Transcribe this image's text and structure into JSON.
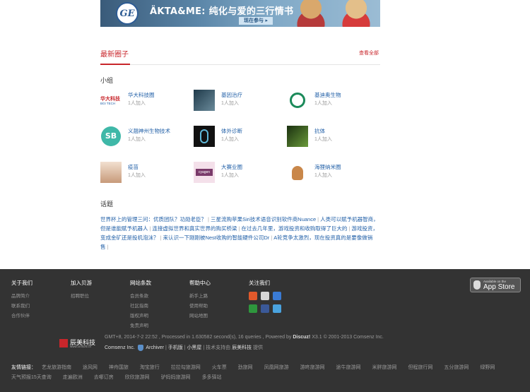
{
  "banner": {
    "ge_text": "GE",
    "title": "ÄKTA&ME: 纯化与爱的三行情书",
    "cta": "现在参与 ▸"
  },
  "section": {
    "title": "最新圈子",
    "see_all": "查看全部"
  },
  "groups_title": "小组",
  "groups": [
    {
      "name": "华大科技圈",
      "members": "1人加入",
      "thumb_text": "华大科技",
      "thumb_sub": "BGI TECH"
    },
    {
      "name": "基因治疗",
      "members": "1人加入"
    },
    {
      "name": "基迪奥生物",
      "members": "1人加入"
    },
    {
      "name": "义翘神州生物技术",
      "members": "1人加入",
      "thumb_text": "SB"
    },
    {
      "name": "体外诊断",
      "members": "1人加入"
    },
    {
      "name": "抗体",
      "members": "1人加入"
    },
    {
      "name": "疫苗",
      "members": "1人加入"
    },
    {
      "name": "大赛业圈",
      "members": "1人加入",
      "thumb_text": "cyagen"
    },
    {
      "name": "海狸纳米圈",
      "members": "1人加入"
    }
  ],
  "topics_title": "话题",
  "topics": [
    "世界杯上的管理三问：优质团队？功勋老臣？",
    "三星流购苹果Siri技术语音识别软件商Nuance",
    "人类可以赋予机器智商，但是谁能赋予机器人",
    "连接虚拟世界和真实世界的购买桥梁",
    "在过去几年里，游戏投资和收购取得了巨大的",
    "游戏投资，变成金矿还是投机泡沫？",
    "来认识一下刚刚被Nest收购的智能硬件公司Dr",
    "A轮竞争太激烈，现在投资真的是要像做销售"
  ],
  "footer": {
    "columns": [
      {
        "heading": "关于我们",
        "links": [
          "品牌简介",
          "联系我们",
          "合作伙伴"
        ]
      },
      {
        "heading": "加入贝游",
        "links": [
          "招聘职位"
        ]
      },
      {
        "heading": "网站条款",
        "links": [
          "会员条款",
          "社区指南",
          "版权声明",
          "免责声明"
        ]
      },
      {
        "heading": "帮助中心",
        "links": [
          "新手上路",
          "使用帮助",
          "网站地图"
        ]
      },
      {
        "heading": "关注我们",
        "links": []
      }
    ],
    "appstore_small": "Available on the",
    "appstore_big": "App Store",
    "company_name": "辰美科技",
    "company_url": "www.cmsoft.cn",
    "copyright_line": "GMT+8, 2014-7-2 22:52 , Processed in 1.630582 second(s), 16 queries , Powered by",
    "powered_by": "Discuz!",
    "version": "X3.1 © 2001-2013 Comsenz Inc.",
    "comsenz": "Comsenz Inc.",
    "archiver": "Archiver",
    "mobile": "手机版",
    "blackroom": "小黑屋",
    "tech_support": "技术支持由",
    "tech_company": "辰美科技",
    "tech_suffix": "提供",
    "links_label": "友情链接：",
    "friend_links": [
      "艺龙旅游指南",
      "途风网",
      "神舟国旅",
      "淘宝旅行",
      "拉拉勾旅游网",
      "火车票",
      "劲旅网",
      "凤凰网旅游",
      "游咚旅游网",
      "途牛旅游网",
      "米胖旅游网",
      "但程旅行网",
      "五分旅游网",
      "绿野网",
      "天气预报15天查询",
      "走遍欧洲",
      "去哪订房",
      "欣欣旅游网",
      "驴妈妈旅游网",
      "多多驿站"
    ]
  }
}
